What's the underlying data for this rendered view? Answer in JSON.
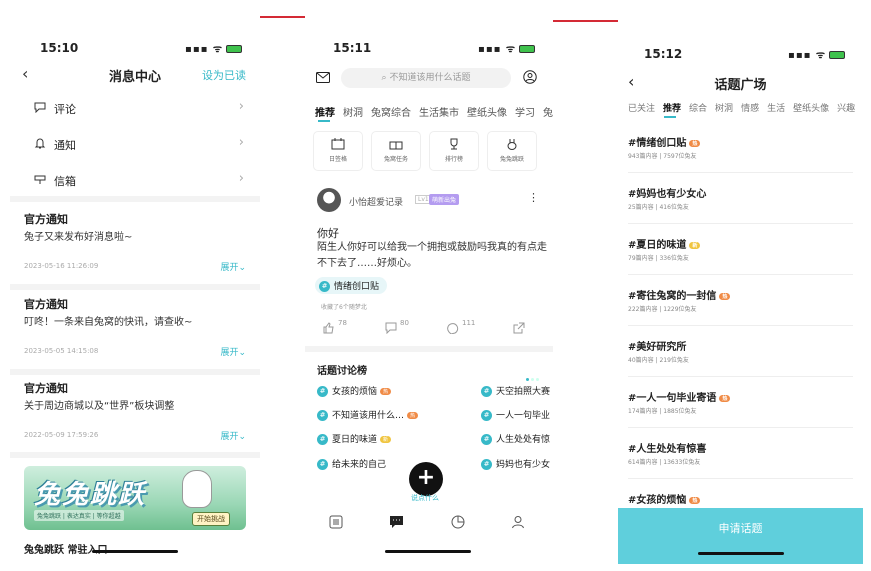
{
  "colors": {
    "accent": "#37b9c8",
    "arrow": "#d42a35",
    "apply_bg": "#5fcfdc",
    "hot": "#f08b46"
  },
  "status": {
    "time1": "15:10",
    "time2": "15:11",
    "time3": "15:12"
  },
  "messages": {
    "title": "消息中心",
    "read_all": "设为已读",
    "menu": [
      {
        "label": "评论",
        "icon": "comment-icon"
      },
      {
        "label": "通知",
        "icon": "bell-icon"
      },
      {
        "label": "信箱",
        "icon": "mailbox-icon"
      }
    ],
    "notices": [
      {
        "title": "官方通知",
        "body": "兔子又来发布好消息啦~",
        "date": "2023-05-16 11:26:09",
        "expand": "展开"
      },
      {
        "title": "官方通知",
        "body": "叮咚！一条来自兔窝的快讯，请查收~",
        "date": "2023-05-05 14:15:08",
        "expand": "展开"
      },
      {
        "title": "官方通知",
        "body": "关于周边商城以及“世界”板块调整",
        "date": "2022-05-09 17:59:26",
        "expand": "展开"
      }
    ],
    "banner": {
      "title": "兔兔跳跃",
      "subtitle": "兔兔跳跃 | 表达真实 | 等你超越",
      "button": "开始挑战"
    },
    "banner_caption": "兔兔跳跃 常驻入口"
  },
  "home": {
    "search_placeholder": "不知道该用什么话题",
    "tabs": [
      "推荐",
      "树洞",
      "兔窝综合",
      "生活集市",
      "壁纸头像",
      "学习",
      "兔友"
    ],
    "quick": [
      {
        "label": "日签格",
        "icon": "calendar-icon"
      },
      {
        "label": "兔窝任务",
        "icon": "gift-icon"
      },
      {
        "label": "排行榜",
        "icon": "trophy-icon"
      },
      {
        "label": "兔兔跳跃",
        "icon": "bunny-icon"
      }
    ],
    "post": {
      "author": "小怡超爱记录",
      "level": "Lv1",
      "badge": "萌新出兔",
      "title": "你好",
      "body": "陌生人你好可以给我一个拥抱或鼓励吗我真的有点走不下去了……好烦心。",
      "topic": "情绪创口贴",
      "fav": "收藏了6个随梦北",
      "likes": "78",
      "comments": "80",
      "hugs": "111"
    },
    "rank_title": "话题讨论榜",
    "rank": [
      {
        "name": "女孩的烦恼",
        "badge": "热"
      },
      {
        "name": "天空拍照大赛",
        "badge": ""
      },
      {
        "name": "不知道该用什么…",
        "badge": "热"
      },
      {
        "name": "一人一句毕业",
        "badge": ""
      },
      {
        "name": "夏日的味道",
        "badge": "新"
      },
      {
        "name": "人生处处有惊",
        "badge": ""
      },
      {
        "name": "给未来的自己",
        "badge": ""
      },
      {
        "name": "妈妈也有少女",
        "badge": ""
      }
    ],
    "fab_hint": "说点什么"
  },
  "topics": {
    "title": "话题广场",
    "tabs": [
      "已关注",
      "推荐",
      "综合",
      "树洞",
      "情感",
      "生活",
      "壁纸头像",
      "兴趣"
    ],
    "items": [
      {
        "name": "#情绪创口贴",
        "stats": "943篇内容 | 7597位兔友",
        "badge": "热"
      },
      {
        "name": "#妈妈也有少女心",
        "stats": "25篇内容 | 416位兔友",
        "badge": ""
      },
      {
        "name": "#夏日的味道",
        "stats": "79篇内容 | 336位兔友",
        "badge": "新"
      },
      {
        "name": "#寄往兔窝的一封信",
        "stats": "222篇内容 | 1229位兔友",
        "badge": "热"
      },
      {
        "name": "#美好研究所",
        "stats": "40篇内容 | 219位兔友",
        "badge": ""
      },
      {
        "name": "#一人一句毕业寄语",
        "stats": "174篇内容 | 1885位兔友",
        "badge": "热"
      },
      {
        "name": "#人生处处有惊喜",
        "stats": "614篇内容 | 13633位兔友",
        "badge": ""
      },
      {
        "name": "#女孩的烦恼",
        "stats": "",
        "badge": "热"
      }
    ],
    "apply": "申请话题"
  }
}
